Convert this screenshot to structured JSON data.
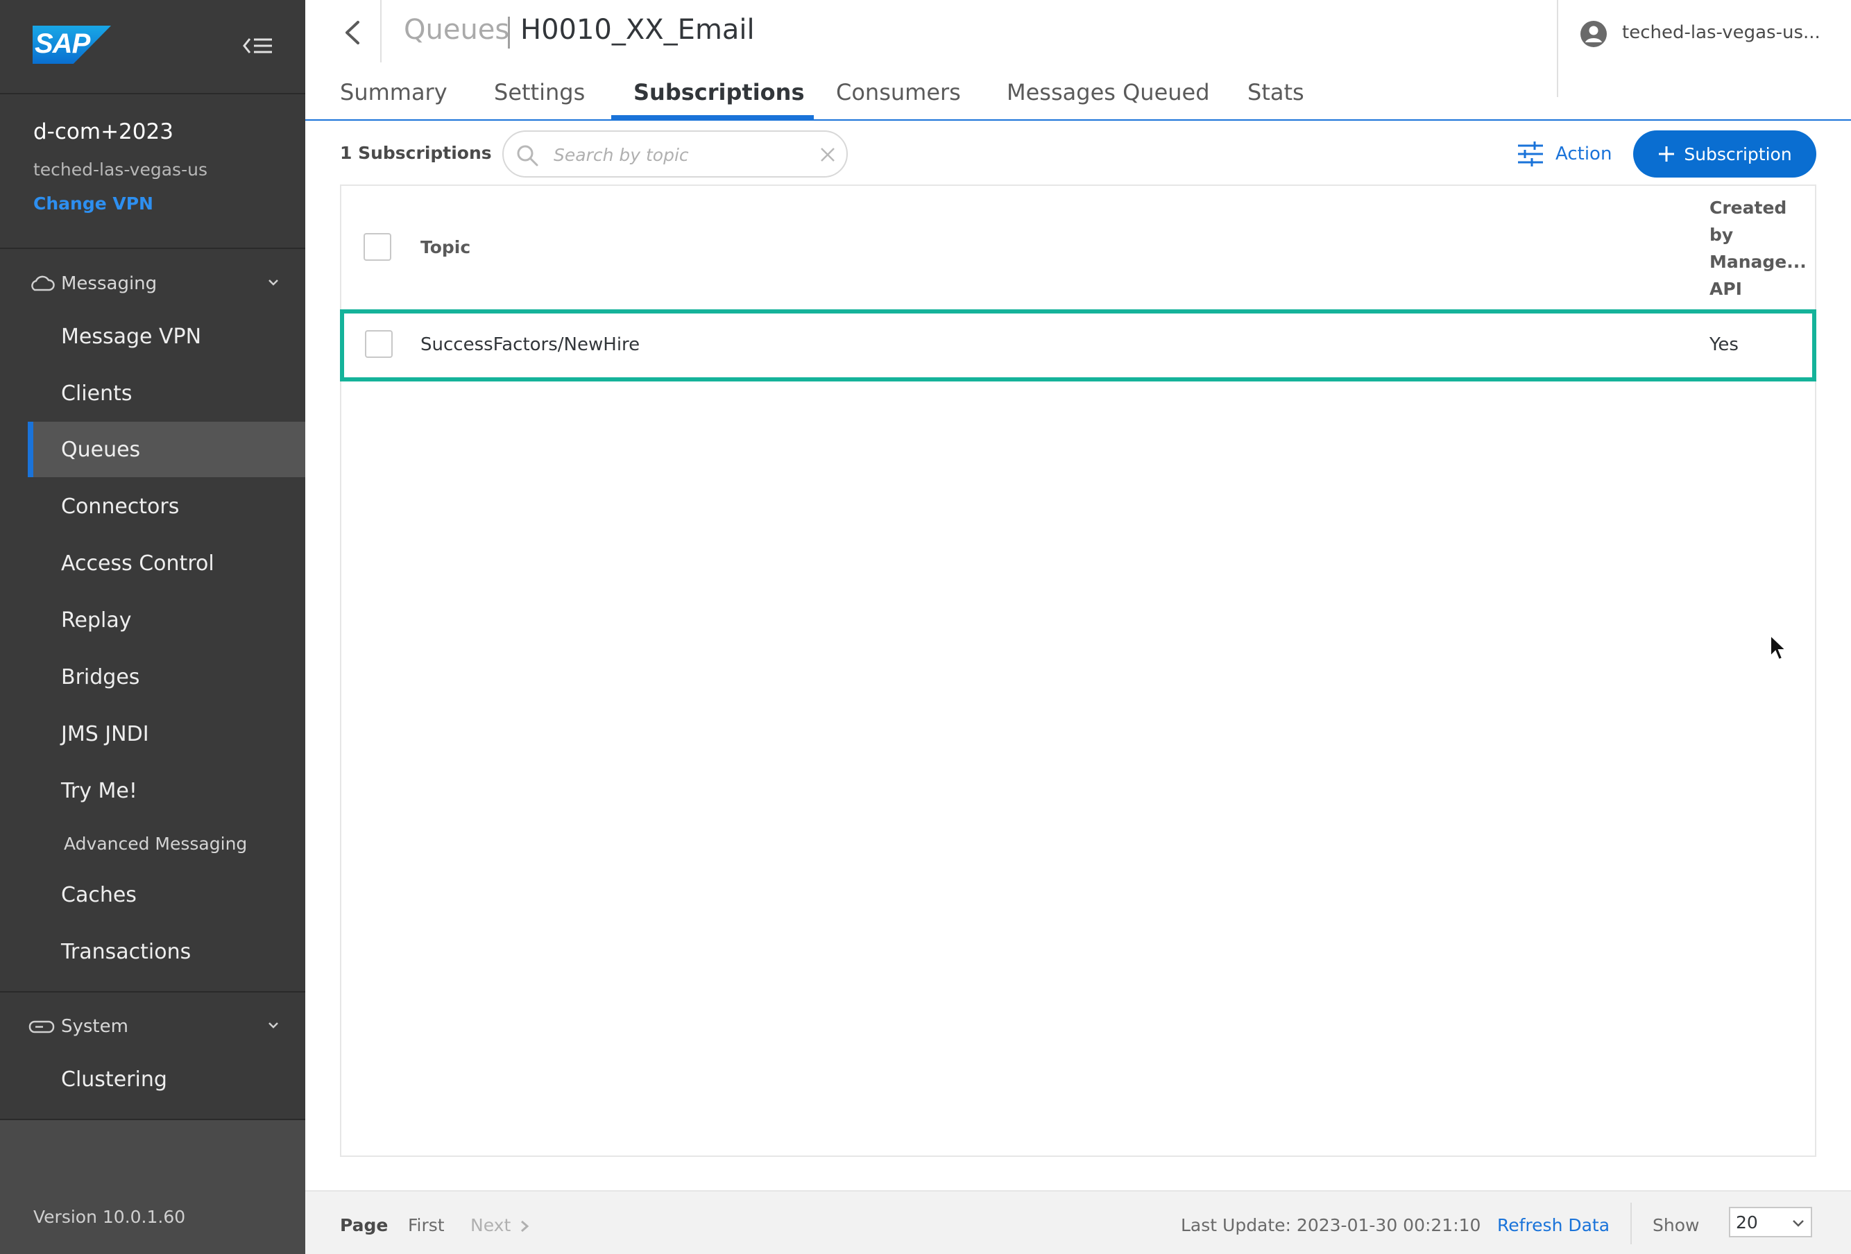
{
  "sidebar": {
    "brand": "SAP",
    "vpn_name": "d-com+2023",
    "vpn_host": "teched-las-vegas-us",
    "change_vpn": "Change VPN",
    "messaging_section": "Messaging",
    "messaging_items": [
      "Message VPN",
      "Clients",
      "Queues",
      "Connectors",
      "Access Control",
      "Replay",
      "Bridges",
      "JMS JNDI",
      "Try Me!",
      "Advanced Messaging",
      "Caches",
      "Transactions"
    ],
    "active_item": "Queues",
    "system_section": "System",
    "system_items": [
      "Clustering"
    ],
    "version": "Version 10.0.1.60"
  },
  "header": {
    "breadcrumb": "Queues",
    "title": "H0010_XX_Email",
    "user": "teched-las-vegas-us..."
  },
  "tabs": [
    "Summary",
    "Settings",
    "Subscriptions",
    "Consumers",
    "Messages Queued",
    "Stats"
  ],
  "active_tab": "Subscriptions",
  "toolbar": {
    "count": "1 Subscriptions",
    "search_placeholder": "Search by topic",
    "action_label": "Action",
    "add_label": "Subscription"
  },
  "table": {
    "columns": [
      "Topic",
      "Created by Manage... API"
    ],
    "col_created_lines": [
      "Created",
      "by",
      "Manage...",
      "API"
    ],
    "rows": [
      {
        "topic": "SuccessFactors/NewHire",
        "created_by_api": "Yes"
      }
    ]
  },
  "footer": {
    "page_label": "Page",
    "first": "First",
    "next": "Next",
    "last_update": "Last Update: 2023-01-30 00:21:10",
    "refresh": "Refresh Data",
    "show_label": "Show",
    "page_size": "20"
  },
  "colors": {
    "accent": "#1a73d9",
    "primary_button": "#0a6ed1",
    "row_highlight": "#15b39a",
    "sidebar_bg": "#3a3a3a"
  }
}
